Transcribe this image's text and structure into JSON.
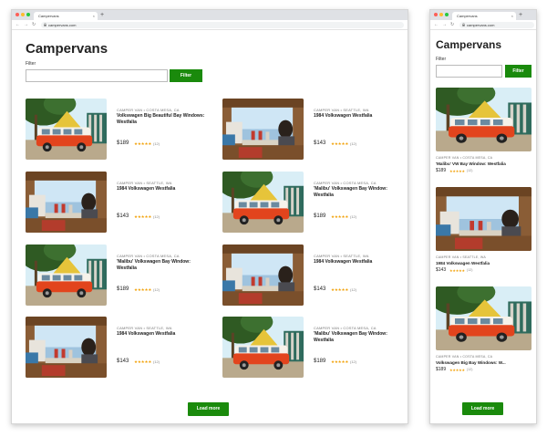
{
  "browser": {
    "tab_title": "Campervans",
    "tab_close": "×",
    "new_tab": "+",
    "url": "campervans.com",
    "back": "←",
    "forward": "→",
    "reload": "↻"
  },
  "page": {
    "title": "Campervans",
    "filter_label": "Filter",
    "filter_value": "",
    "filter_button": "Filter",
    "load_more": "Load more"
  },
  "desktop_listings": [
    {
      "meta": "CAMPER VAN • COSTA MESA, CA",
      "title": "Volkswagen Big Beautiful Bay Windows: Westfalia",
      "price": "$189",
      "stars": "★★★★★",
      "reviews": "(12)",
      "image": "van"
    },
    {
      "meta": "CAMPER VAN • SEATTLE, WA",
      "title": "1984 Volkswagen Westfalia",
      "price": "$143",
      "stars": "★★★★★",
      "reviews": "(12)",
      "image": "interior"
    },
    {
      "meta": "CAMPER VAN • SEATTLE, WA",
      "title": "1984 Volkswagen Westfalia",
      "price": "$143",
      "stars": "★★★★★",
      "reviews": "(12)",
      "image": "interior"
    },
    {
      "meta": "CAMPER VAN • COSTA MESA, CA",
      "title": "'Malibu' Volkswagen Bay Window: Westfalia",
      "price": "$189",
      "stars": "★★★★★",
      "reviews": "(12)",
      "image": "van"
    },
    {
      "meta": "CAMPER VAN • COSTA MESA, CA",
      "title": "'Malibu' Volkswagen Bay Window: Westfalia",
      "price": "$189",
      "stars": "★★★★★",
      "reviews": "(12)",
      "image": "van"
    },
    {
      "meta": "CAMPER VAN • SEATTLE, WA",
      "title": "1984 Volkswagen Westfalia",
      "price": "$143",
      "stars": "★★★★★",
      "reviews": "(12)",
      "image": "interior"
    },
    {
      "meta": "CAMPER VAN • SEATTLE, WA",
      "title": "1984 Volkswagen Westfalia",
      "price": "$143",
      "stars": "★★★★★",
      "reviews": "(12)",
      "image": "interior"
    },
    {
      "meta": "CAMPER VAN • COSTA MESA, CA",
      "title": "'Malibu' Volkswagen Bay Window: Westfalia",
      "price": "$189",
      "stars": "★★★★★",
      "reviews": "(12)",
      "image": "van"
    }
  ],
  "mobile_listings": [
    {
      "meta": "CAMPER VAN • COSTA MESA, CA",
      "title": "'Malibu' VW Bay Window: Westfalia",
      "price": "$189",
      "stars": "★★★★★",
      "reviews": "(12)",
      "image": "van"
    },
    {
      "meta": "CAMPER VAN • SEATTLE, WA",
      "title": "1984 Volkswagen Westfalia",
      "price": "$143",
      "stars": "★★★★★",
      "reviews": "(12)",
      "image": "interior"
    },
    {
      "meta": "CAMPER VAN • COSTA MESA, CA",
      "title": "Volkswagen Big Bay Windows: W...",
      "price": "$189",
      "stars": "★★★★★",
      "reviews": "(12)",
      "image": "van"
    }
  ],
  "colors": {
    "accent": "#1a8a0c",
    "star": "#f2a20a"
  }
}
